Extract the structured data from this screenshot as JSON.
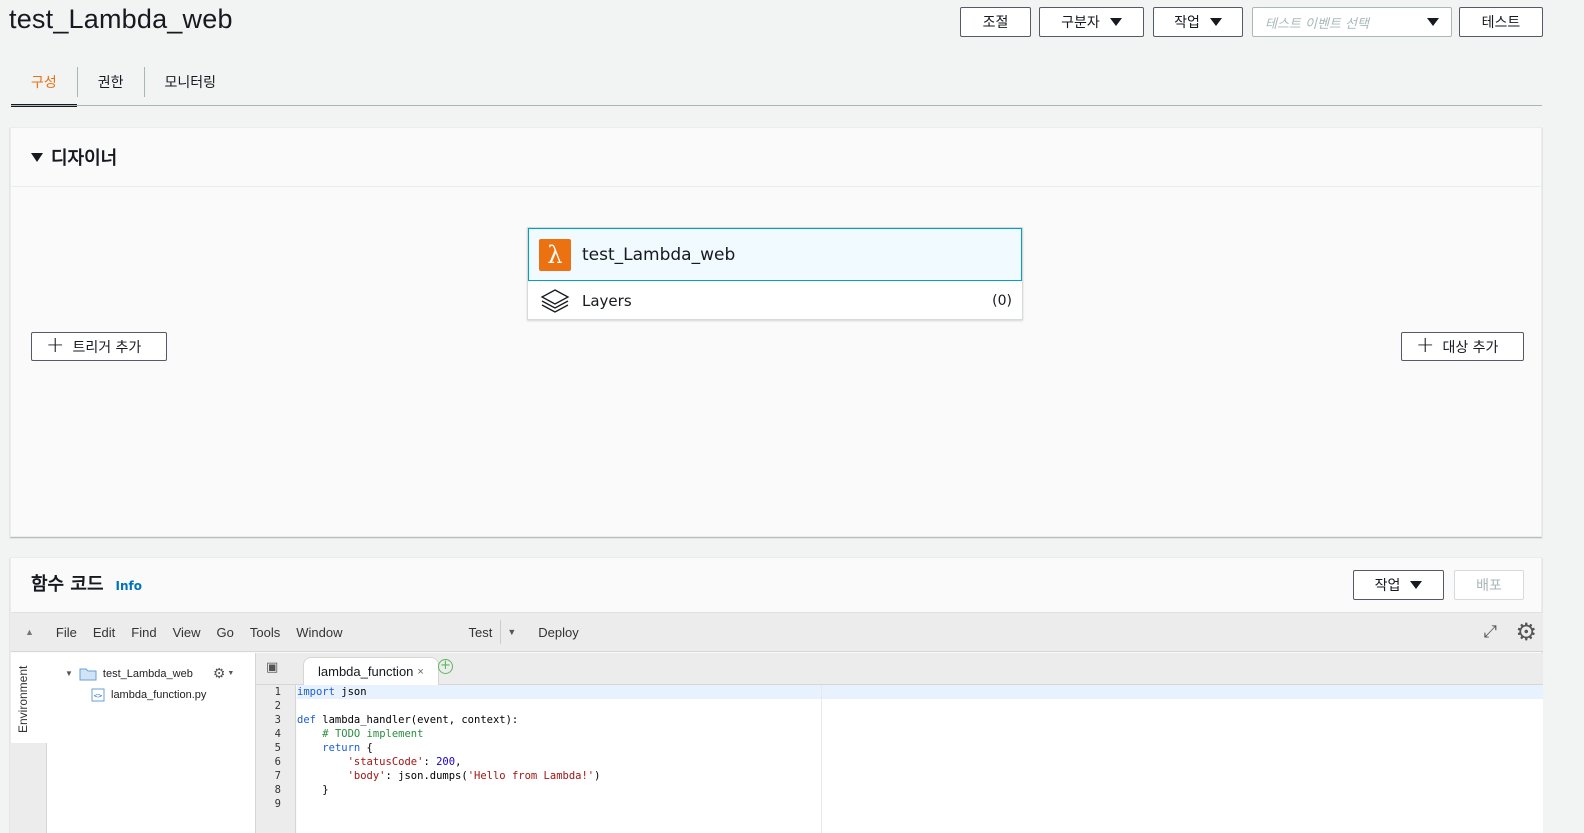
{
  "header": {
    "title": "test_Lambda_web",
    "throttle_label": "조절",
    "qualifiers_label": "구분자",
    "actions_label": "작업",
    "test_event_placeholder": "테스트 이벤트 선택",
    "test_label": "테스트"
  },
  "tabs": [
    {
      "label": "구성",
      "active": true
    },
    {
      "label": "권한",
      "active": false
    },
    {
      "label": "모니터링",
      "active": false
    }
  ],
  "designer": {
    "title": "디자이너",
    "function_name": "test_Lambda_web",
    "layers_label": "Layers",
    "layers_count": "(0)",
    "add_trigger_label": "트리거 추가",
    "add_destination_label": "대상 추가"
  },
  "function_code": {
    "title": "함수 코드",
    "info_label": "Info",
    "actions_label": "작업",
    "deploy_label": "배포"
  },
  "ide": {
    "menu": [
      "File",
      "Edit",
      "Find",
      "View",
      "Go",
      "Tools",
      "Window"
    ],
    "test_label": "Test",
    "deploy_label": "Deploy",
    "environment_label": "Environment",
    "folder_name": "test_Lambda_web",
    "file_name": "lambda_function.py",
    "tab_name": "lambda_function",
    "line_numbers": [
      "1",
      "2",
      "3",
      "4",
      "5",
      "6",
      "7",
      "8",
      "9"
    ]
  },
  "colors": {
    "accent": "#ec7211",
    "link": "#0073bb",
    "selected_border": "#00a1c9"
  }
}
